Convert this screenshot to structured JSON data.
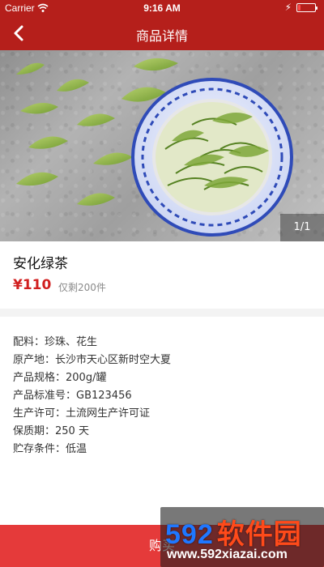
{
  "status_bar": {
    "carrier": "Carrier",
    "time": "9:16 AM"
  },
  "nav": {
    "title": "商品详情",
    "back_icon": "chevron-left-icon"
  },
  "gallery": {
    "counter": "1/1"
  },
  "product": {
    "name": "安化绿茶",
    "price": "¥110",
    "stock": "仅剩200件"
  },
  "specs": [
    "配料：珍珠、花生",
    "原产地：长沙市天心区新时空大夏",
    "产品规格：200g/罐",
    "产品标准号：GB123456",
    "生产许可：土流网生产许可证",
    "保质期：250 天",
    "贮存条件：低温"
  ],
  "buy": {
    "label": "购买"
  },
  "watermark": {
    "text_number": "592",
    "text_cn": "软件园",
    "url": "www.592xiazai.com"
  },
  "colors": {
    "header": "#b51f1b",
    "price": "#d11f1f",
    "buy": "#e53a3a"
  }
}
